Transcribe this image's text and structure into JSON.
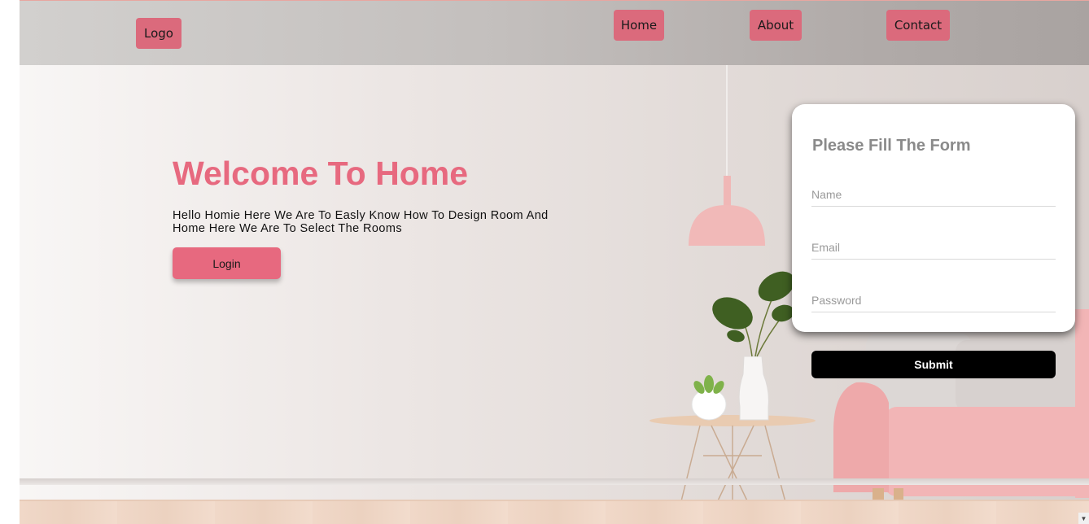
{
  "nav": {
    "logo": "Logo",
    "home": "Home",
    "about": "About",
    "contact": "Contact"
  },
  "hero": {
    "title": "Welcome To Home",
    "text": "Hello Homie Here We Are To Easly Know How To Design Room And Home Here We Are To Select The Rooms",
    "login_label": "Login"
  },
  "form": {
    "title": "Please Fill The Form",
    "name_placeholder": "Name",
    "email_placeholder": "Email",
    "password_placeholder": "Password",
    "submit_label": "Submit"
  },
  "colors": {
    "accent": "#e7697f",
    "nav_button": "#db6a7c",
    "submit": "#000000"
  },
  "icons": {
    "scroll_down": "chevron-down-icon"
  }
}
